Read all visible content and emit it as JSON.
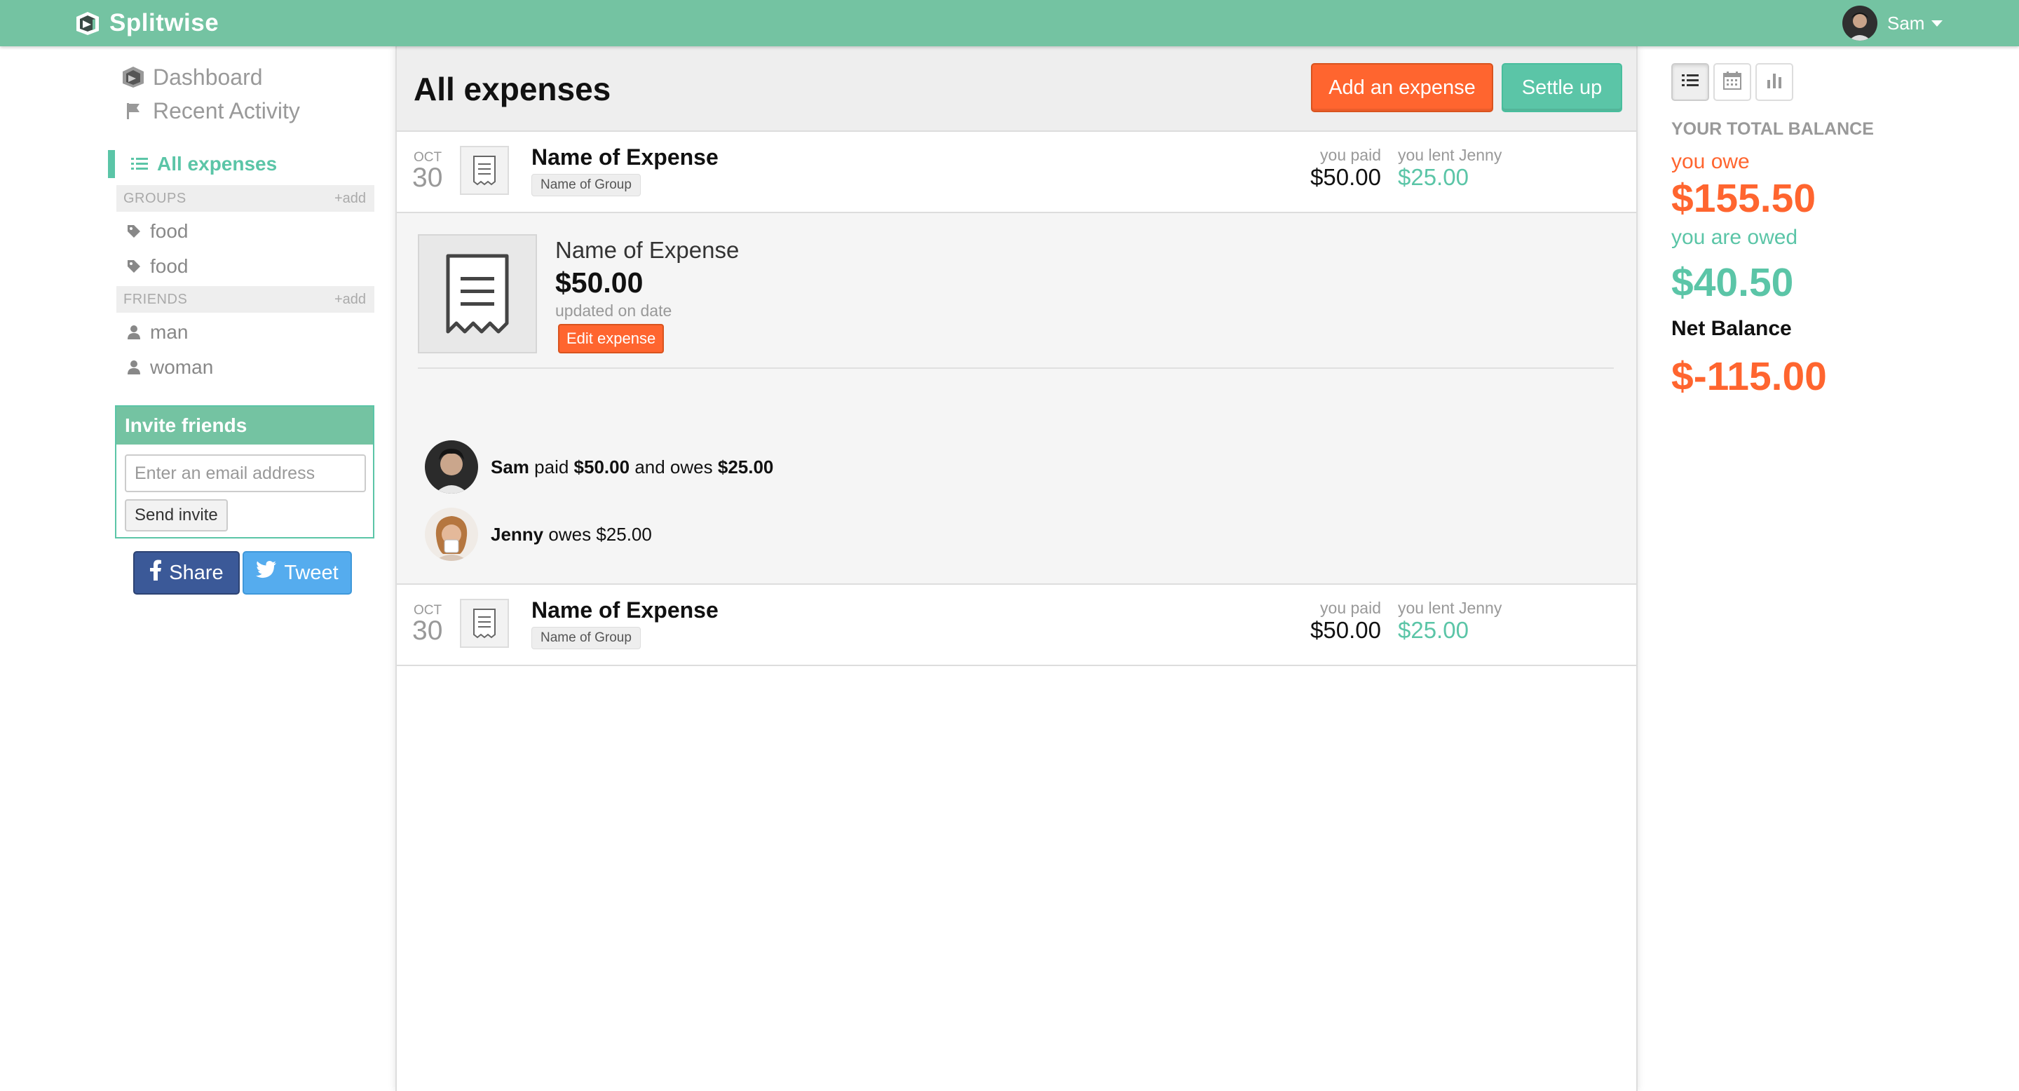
{
  "app": {
    "name": "Splitwise"
  },
  "user": {
    "name": "Sam"
  },
  "sidebar": {
    "dashboard": "Dashboard",
    "recent_activity": "Recent Activity",
    "all_expenses": "All expenses",
    "groups_title": "GROUPS",
    "groups_add": "add",
    "groups": [
      "food",
      "food"
    ],
    "friends_title": "FRIENDS",
    "friends_add": "add",
    "friends": [
      "man",
      "woman"
    ],
    "invite": {
      "title": "Invite friends",
      "placeholder": "Enter an email address",
      "button": "Send invite"
    },
    "share_label": "Share",
    "tweet_label": "Tweet"
  },
  "main": {
    "title": "All expenses",
    "add_button": "Add an expense",
    "settle_button": "Settle up",
    "expenses": [
      {
        "month": "OCT",
        "day": "30",
        "name": "Name of Expense",
        "group": "Name of Group",
        "paid_label": "you paid",
        "paid_amount": "$50.00",
        "lent_label": "you lent Jenny",
        "lent_amount": "$25.00"
      },
      {
        "month": "OCT",
        "day": "30",
        "name": "Name of Expense",
        "group": "Name of Group",
        "paid_label": "you paid",
        "paid_amount": "$50.00",
        "lent_label": "you lent Jenny",
        "lent_amount": "$25.00"
      }
    ],
    "detail": {
      "name": "Name of Expense",
      "amount": "$50.00",
      "updated": "updated on date",
      "edit_button": "Edit expense",
      "shares": [
        {
          "person": "Sam",
          "v1": "paid",
          "amount1": "$50.00",
          "v2": "and owes",
          "amount2": "$25.00"
        },
        {
          "person": "Jenny",
          "v1": "owes",
          "amount1": "$25.00"
        }
      ]
    }
  },
  "balance": {
    "title": "YOUR TOTAL BALANCE",
    "you_owe_label": "you owe",
    "you_owe": "$155.50",
    "owed_label": "you are owed",
    "owed": "$40.50",
    "net_label": "Net Balance",
    "net": "$-115.00"
  },
  "colors": {
    "brand": "#74c3a2",
    "accent_green": "#5bc5a7",
    "accent_orange": "#ff652f"
  },
  "icons": [
    "splitwise-logo-icon",
    "dashboard-icon",
    "flag-icon",
    "list-icon",
    "tag-icon",
    "person-icon",
    "plus-icon",
    "facebook-icon",
    "twitter-icon",
    "receipt-icon",
    "calendar-icon",
    "bar-chart-icon",
    "caret-down-icon"
  ]
}
